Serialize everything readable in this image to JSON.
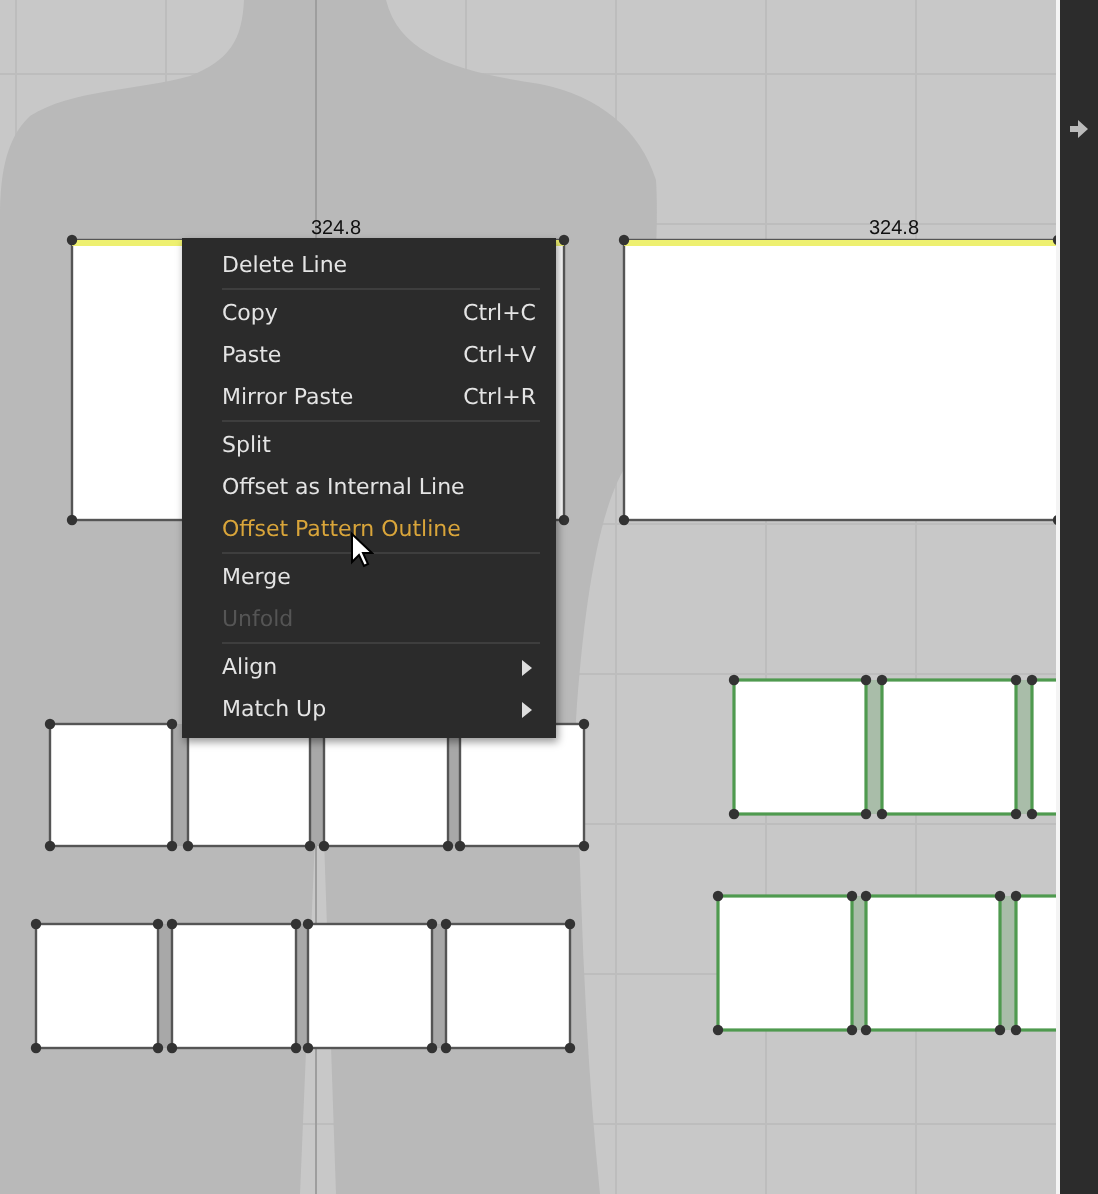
{
  "canvas": {
    "pieces": [
      {
        "label": "324.8"
      },
      {
        "label": "324.8"
      }
    ],
    "piece_rows": [
      {
        "selected": false
      },
      {
        "selected": false
      },
      {
        "selected": true
      },
      {
        "selected": true
      }
    ]
  },
  "context_menu": {
    "items": [
      {
        "kind": "item",
        "label": "Delete Line",
        "highlighted": false,
        "disabled": false
      },
      {
        "kind": "separator"
      },
      {
        "kind": "item",
        "label": "Copy",
        "shortcut": "Ctrl+C",
        "highlighted": false,
        "disabled": false
      },
      {
        "kind": "item",
        "label": "Paste",
        "shortcut": "Ctrl+V",
        "highlighted": false,
        "disabled": false
      },
      {
        "kind": "item",
        "label": "Mirror Paste",
        "shortcut": "Ctrl+R",
        "highlighted": false,
        "disabled": false
      },
      {
        "kind": "separator"
      },
      {
        "kind": "item",
        "label": "Split",
        "highlighted": false,
        "disabled": false
      },
      {
        "kind": "item",
        "label": "Offset as Internal Line",
        "highlighted": false,
        "disabled": false
      },
      {
        "kind": "item",
        "label": "Offset Pattern Outline",
        "highlighted": true,
        "disabled": false
      },
      {
        "kind": "separator"
      },
      {
        "kind": "item",
        "label": "Merge",
        "highlighted": false,
        "disabled": false
      },
      {
        "kind": "item",
        "label": "Unfold",
        "highlighted": false,
        "disabled": true
      },
      {
        "kind": "separator"
      },
      {
        "kind": "submenu",
        "label": "Align",
        "highlighted": false,
        "disabled": false
      },
      {
        "kind": "submenu",
        "label": "Match Up",
        "highlighted": false,
        "disabled": false
      }
    ]
  }
}
